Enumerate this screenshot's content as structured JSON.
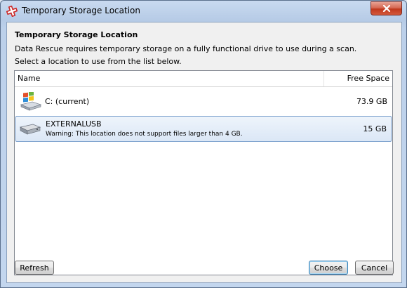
{
  "window": {
    "title": "Temporary Storage Location"
  },
  "dialog": {
    "heading": "Temporary Storage Location",
    "description_line1": "Data Rescue requires temporary storage on a fully functional drive to use during a scan.",
    "description_line2": "Select a location to use from the list below."
  },
  "list": {
    "columns": [
      "Name",
      "Free Space"
    ],
    "rows": [
      {
        "name": "C: (current)",
        "free_space": "73.9 GB",
        "icon": "windows-drive-icon",
        "selected": false
      },
      {
        "name": "EXTERNALUSB",
        "warning": "Warning: This location does not support files larger than 4 GB.",
        "free_space": "15 GB",
        "icon": "usb-drive-icon",
        "selected": true
      }
    ]
  },
  "buttons": {
    "refresh": "Refresh",
    "choose": "Choose",
    "cancel": "Cancel"
  },
  "colors": {
    "selection_border": "#7da2ce",
    "close_button": "#c0391e",
    "app_icon": "#cc2a2a"
  }
}
